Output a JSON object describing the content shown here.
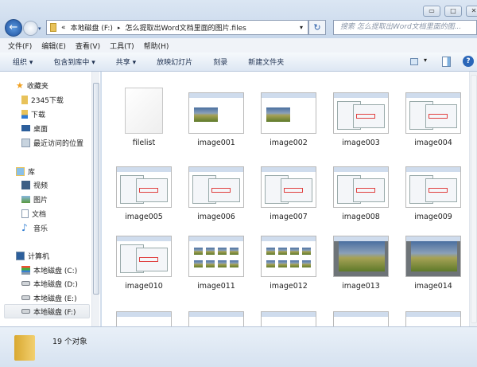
{
  "window": {
    "minimize": "▭",
    "maximize": "□",
    "close": "✕"
  },
  "address": {
    "back_icon": "back-arrow-icon",
    "path": [
      "«",
      "本地磁盘 (F:)",
      "▸",
      "怎么提取出Word文档里面的图片.files"
    ],
    "dropdown": "▾",
    "refresh": "↻"
  },
  "search": {
    "placeholder": "搜索 怎么提取出Word文档里面的图..."
  },
  "menu": [
    "文件(F)",
    "编辑(E)",
    "查看(V)",
    "工具(T)",
    "帮助(H)"
  ],
  "toolbar": {
    "items": [
      "组织 ▾",
      "包含到库中 ▾",
      "共享 ▾",
      "放映幻灯片",
      "刻录",
      "新建文件夹"
    ],
    "view": "▾",
    "help": "?"
  },
  "nav": {
    "favorites": {
      "label": "收藏夹",
      "items": [
        "2345下载",
        "下载",
        "桌面",
        "最近访问的位置"
      ]
    },
    "libraries": {
      "label": "库",
      "items": [
        "视频",
        "图片",
        "文档",
        "音乐"
      ]
    },
    "computer": {
      "label": "计算机",
      "items": [
        "本地磁盘 (C:)",
        "本地磁盘 (D:)",
        "本地磁盘 (E:)",
        "本地磁盘 (F:)"
      ],
      "selected": "本地磁盘 (F:)"
    }
  },
  "files": [
    "filelist",
    "image001",
    "image002",
    "image003",
    "image004",
    "image005",
    "image006",
    "image007",
    "image008",
    "image009",
    "image010",
    "image011",
    "image012",
    "image013",
    "image014",
    "",
    "",
    "",
    "",
    ""
  ],
  "status": {
    "count": "19 个对象"
  }
}
